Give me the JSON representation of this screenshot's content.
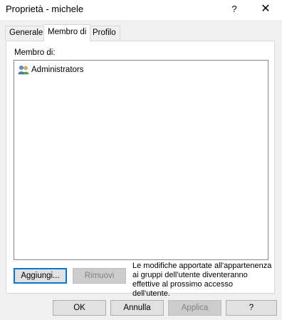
{
  "window": {
    "title": "Proprietà - michele",
    "help_glyph": "?",
    "close_glyph": "✕"
  },
  "tabs": [
    {
      "label": "Generale",
      "active": false
    },
    {
      "label": "Membro di",
      "active": true
    },
    {
      "label": "Profilo",
      "active": false
    }
  ],
  "membership": {
    "label": "Membro di:",
    "items": [
      {
        "name": "Administrators",
        "icon": "group-icon"
      }
    ]
  },
  "actions": {
    "add_label": "Aggiungi...",
    "remove_label": "Rimuovi"
  },
  "note": "Le modifiche apportate all'appartenenza ai gruppi dell'utente diventeranno effettive al prossimo accesso dell'utente.",
  "footer": {
    "ok_label": "OK",
    "cancel_label": "Annulla",
    "apply_label": "Applica",
    "help_label": "?"
  }
}
